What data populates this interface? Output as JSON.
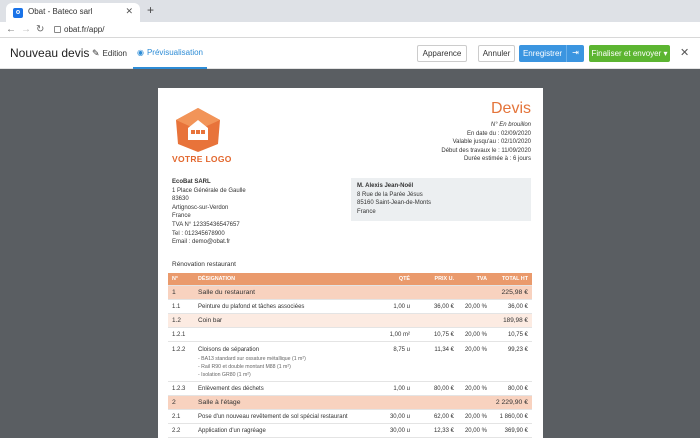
{
  "browser": {
    "tab_title": "Obat - Bateco sarl",
    "tab_close": "✕",
    "new_tab": "+",
    "url": "obat.fr/app/"
  },
  "header": {
    "title": "Nouveau devis",
    "tab_edition": "Edition",
    "tab_preview": "Prévisualisation",
    "btn_apparence": "Apparence",
    "btn_annuler": "Annuler",
    "btn_enregistrer": "Enregistrer",
    "btn_finaliser": "Finaliser et envoyer",
    "close": "✕"
  },
  "document": {
    "logo_text": "VOTRE LOGO",
    "title": "Devis",
    "meta": {
      "number": "N° En brouillon",
      "date": "En date du : 02/09/2020",
      "valid": "Valable jusqu'au : 02/10/2020",
      "start": "Début des travaux le : 11/09/2020",
      "duration": "Durée estimée à : 6 jours"
    },
    "company": {
      "name": "EcoBat SARL",
      "address1": "1 Place Générale de Gaulle",
      "zip": "83630",
      "city": "Artignosc-sur-Verdon",
      "country": "France",
      "tva": "TVA N° 12335436547657",
      "tel": "Tel : 012345678900",
      "email": "Email : demo@obat.fr"
    },
    "client": {
      "name": "M. Alexis Jean-Noël",
      "address": "8 Rue de la Parée Jésus",
      "city": "85160 Saint-Jean-de-Monts",
      "country": "France"
    },
    "project": "Rénovation restaurant",
    "table": {
      "headers": {
        "num": "N°",
        "designation": "DÉSIGNATION",
        "qte": "QTÉ",
        "pu": "PRIX U.",
        "tva": "TVA",
        "total": "TOTAL HT"
      },
      "rows": [
        {
          "num": "1",
          "designation": "Salle du restaurant",
          "qte": "",
          "pu": "",
          "tva": "",
          "total": "225,98 €"
        },
        {
          "num": "1.1",
          "designation": "Peinture du plafond et tâches associées",
          "qte": "1,00 u",
          "pu": "36,00 €",
          "tva": "20,00 %",
          "total": "36,00 €"
        },
        {
          "num": "1.2",
          "designation": "Coin bar",
          "qte": "",
          "pu": "",
          "tva": "",
          "total": "189,98 €"
        },
        {
          "num": "1.2.1",
          "designation": "",
          "qte": "1,00 m²",
          "pu": "10,75 €",
          "tva": "20,00 %",
          "total": "10,75 €"
        },
        {
          "num": "1.2.2",
          "designation": "Cloisons de séparation",
          "qte": "8,75 u",
          "pu": "11,34 €",
          "tva": "20,00 %",
          "total": "99,23 €",
          "details": [
            "- BA13 standard sur ossature métallique (1 m²)",
            "- Rail R90 et double montant M88 (1 m²)",
            "- Isolation GR80 (1 m²)"
          ]
        },
        {
          "num": "1.2.3",
          "designation": "Enlèvement des déchets",
          "qte": "1,00 u",
          "pu": "80,00 €",
          "tva": "20,00 %",
          "total": "80,00 €"
        },
        {
          "num": "2",
          "designation": "Salle à l'étage",
          "qte": "",
          "pu": "",
          "tva": "",
          "total": "2 229,90 €"
        },
        {
          "num": "2.1",
          "designation": "Pose d'un nouveau revêtement de sol spécial restaurant",
          "qte": "30,00 u",
          "pu": "62,00 €",
          "tva": "20,00 %",
          "total": "1 860,00 €"
        },
        {
          "num": "2.2",
          "designation": "Application d'un ragréage",
          "qte": "30,00 u",
          "pu": "12,33 €",
          "tva": "20,00 %",
          "total": "369,90 €"
        }
      ]
    }
  }
}
